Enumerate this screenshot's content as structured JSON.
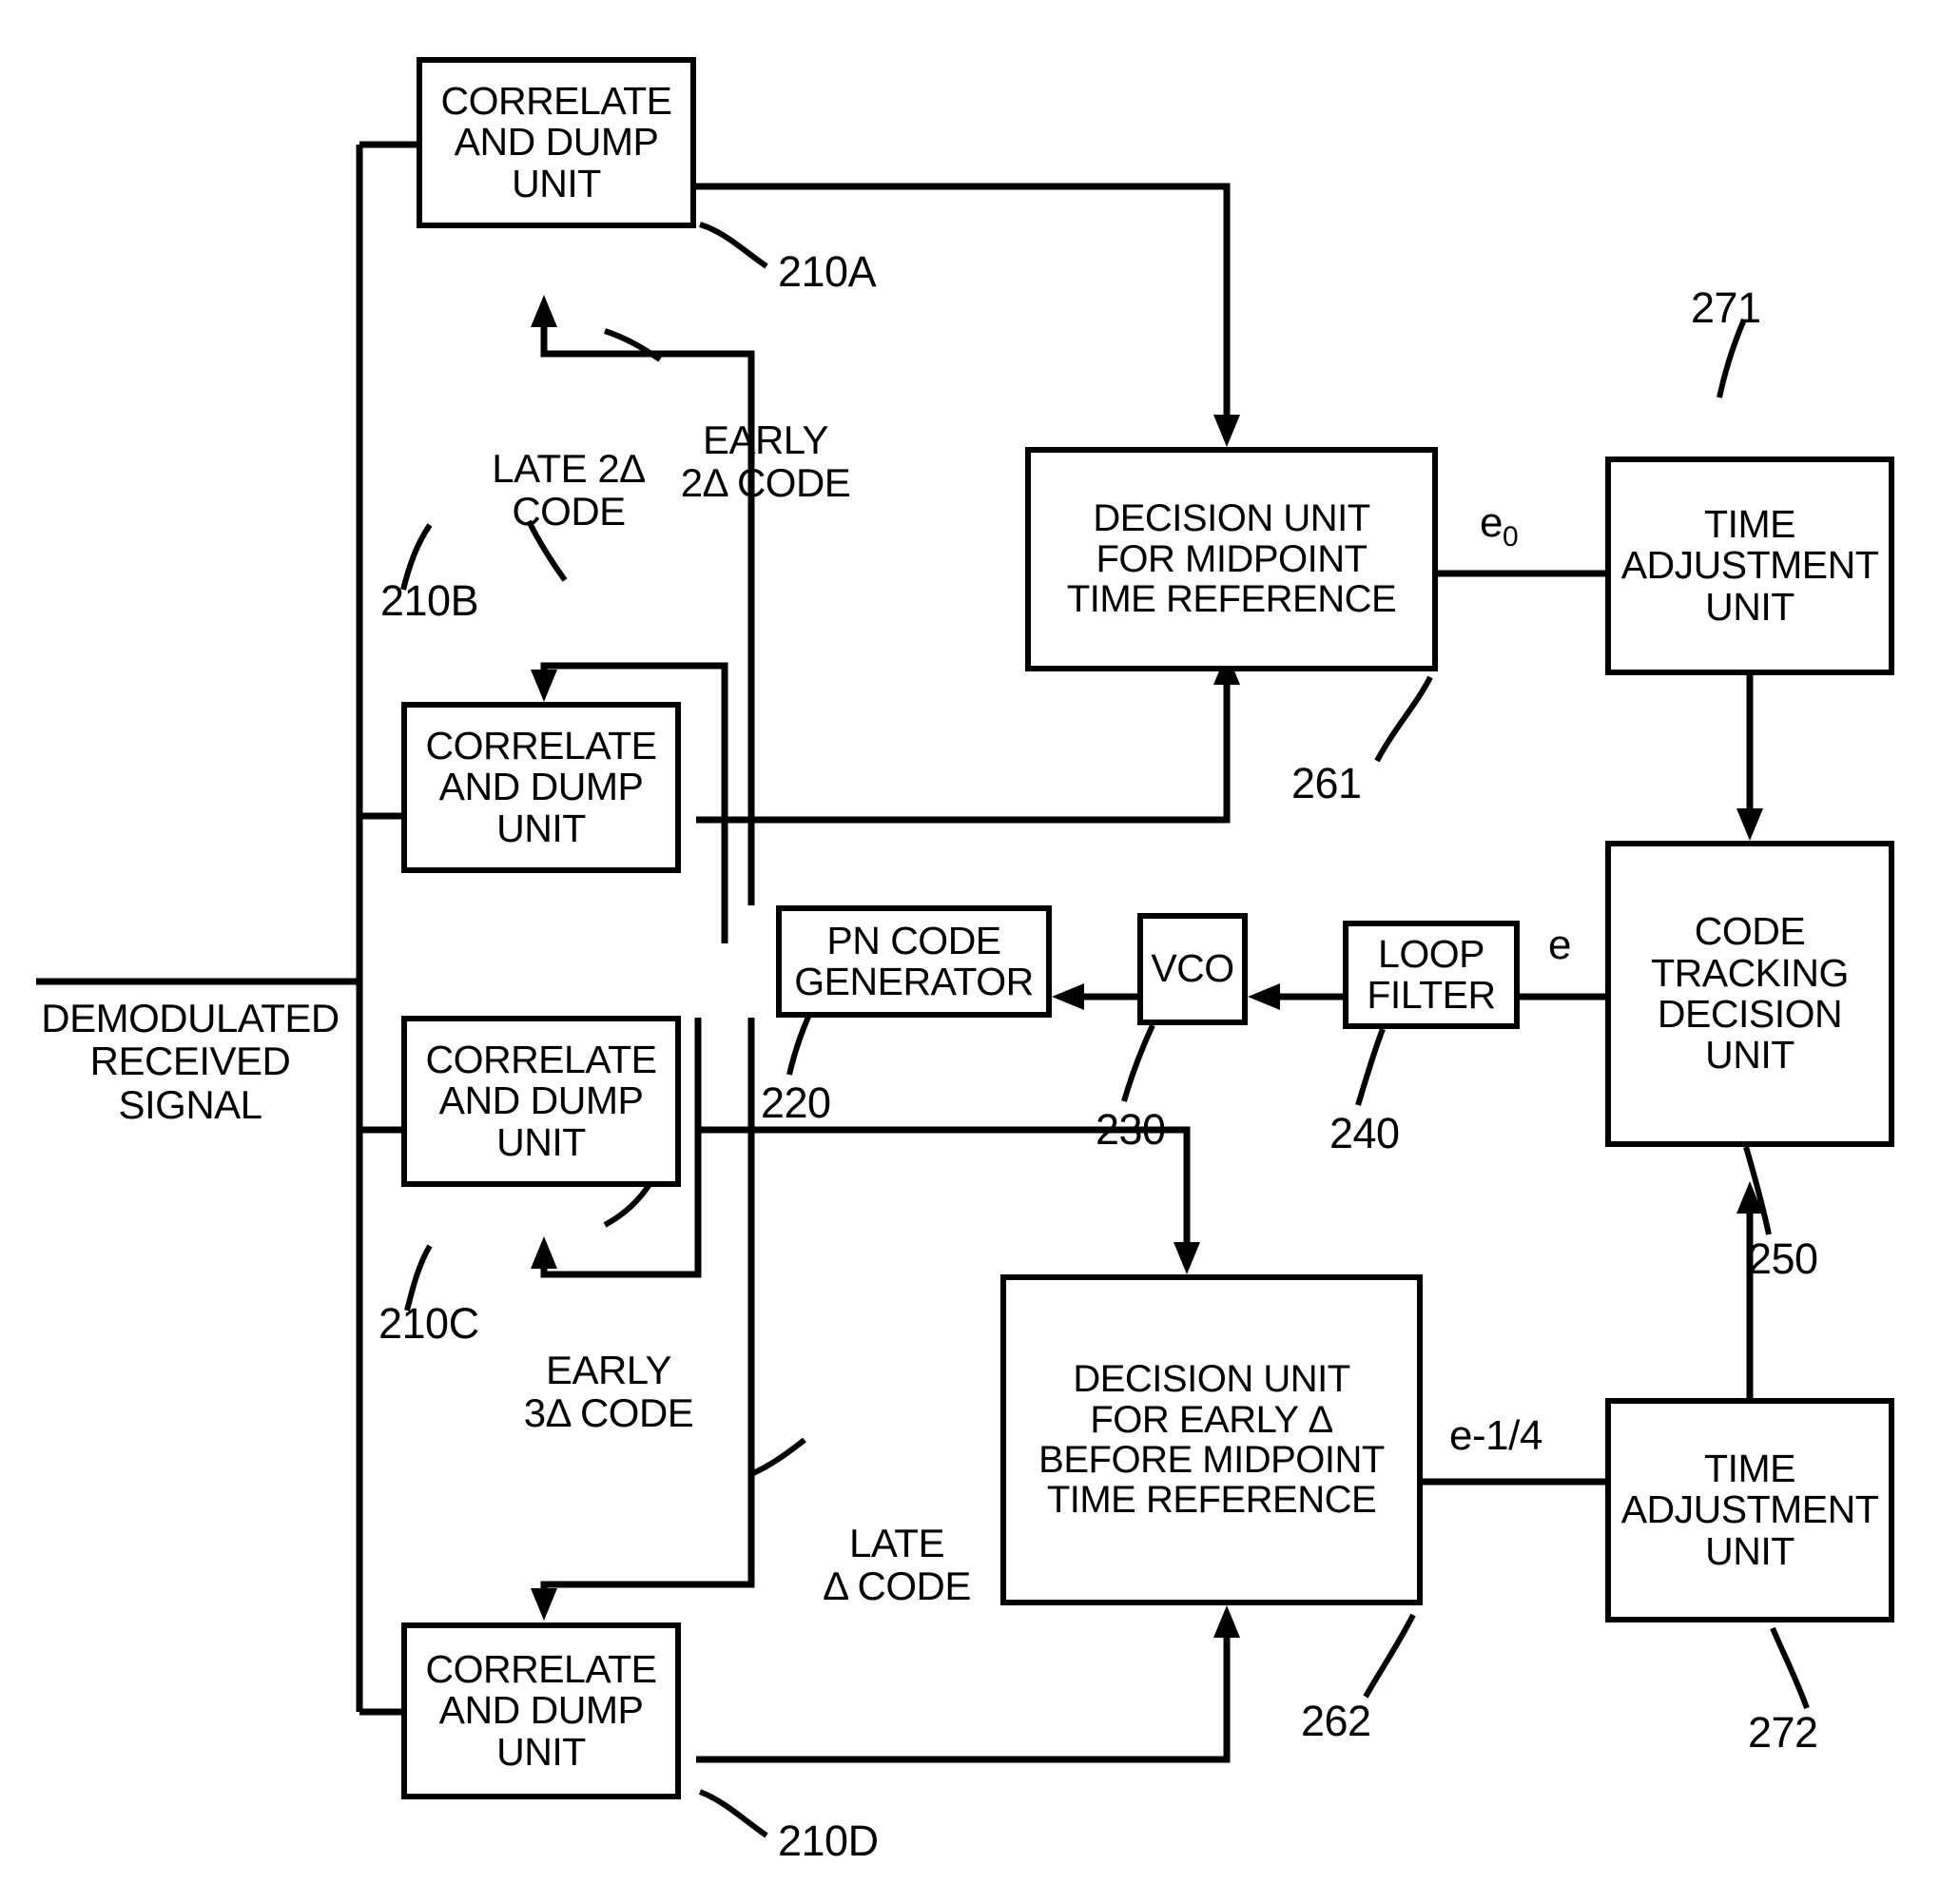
{
  "figure": {
    "type": "patent-block-diagram",
    "title": "Code tracking loop with multiple correlate and dump units"
  },
  "input_label": {
    "line1": "DEMODULATED",
    "line2": "RECEIVED",
    "line3": "SIGNAL"
  },
  "blocks": {
    "cdu_a": {
      "line1": "CORRELATE",
      "line2": "AND DUMP",
      "line3": "UNIT",
      "ref": "210A"
    },
    "cdu_b": {
      "line1": "CORRELATE",
      "line2": "AND DUMP",
      "line3": "UNIT",
      "ref": "210B"
    },
    "cdu_c": {
      "line1": "CORRELATE",
      "line2": "AND DUMP",
      "line3": "UNIT",
      "ref": "210C"
    },
    "cdu_d": {
      "line1": "CORRELATE",
      "line2": "AND DUMP",
      "line3": "UNIT",
      "ref": "210D"
    },
    "decision_midpoint": {
      "line1": "DECISION UNIT",
      "line2": "FOR MIDPOINT",
      "line3": "TIME REFERENCE",
      "ref": "261"
    },
    "decision_early": {
      "line1": "DECISION UNIT",
      "line2": "FOR EARLY Δ",
      "line3": "BEFORE MIDPOINT",
      "line4": "TIME REFERENCE",
      "ref": "262"
    },
    "time_adjust_upper": {
      "line1": "TIME",
      "line2": "ADJUSTMENT",
      "line3": "UNIT",
      "ref": "271"
    },
    "time_adjust_lower": {
      "line1": "TIME",
      "line2": "ADJUSTMENT",
      "line3": "UNIT",
      "ref": "272"
    },
    "code_tracking": {
      "line1": "CODE",
      "line2": "TRACKING",
      "line3": "DECISION",
      "line4": "UNIT",
      "ref": "250"
    },
    "pn_code_generator": {
      "line1": "PN CODE",
      "line2": "GENERATOR",
      "ref": "220"
    },
    "vco": {
      "line1": "VCO",
      "ref": "230"
    },
    "loop_filter": {
      "line1": "LOOP",
      "line2": "FILTER",
      "ref": "240"
    }
  },
  "code_labels": {
    "early_2delta": {
      "line1": "EARLY",
      "line2": "2Δ CODE"
    },
    "late_2delta": {
      "line1": "LATE 2Δ",
      "line2": "CODE"
    },
    "early_3delta": {
      "line1": "EARLY",
      "line2": "3Δ CODE"
    },
    "late_delta": {
      "line1": "LATE",
      "line2": "Δ CODE"
    }
  },
  "signal_labels": {
    "e_zero": "e",
    "e_zero_sub": "0",
    "e": "e",
    "e_minus_quarter": "e-1/4"
  }
}
